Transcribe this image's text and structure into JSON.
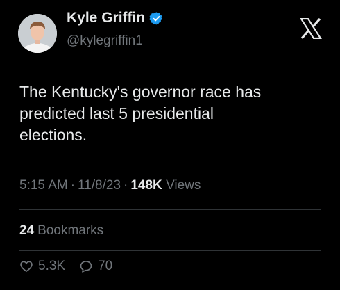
{
  "author": {
    "display_name": "Kyle Griffin",
    "handle": "@kylegriffin1",
    "verified": true,
    "badge_color": "#1d9bf0"
  },
  "brand_icon": "x-logo",
  "tweet": {
    "text_lines": [
      "The Kentucky's governor race has",
      "predicted last 5 presidential",
      "elections."
    ]
  },
  "meta": {
    "time": "5:15 AM",
    "date": "11/8/23",
    "separator": "·",
    "views_count": "148K",
    "views_label": "Views"
  },
  "bookmarks": {
    "count": "24",
    "label": "Bookmarks"
  },
  "actions": {
    "likes": "5.3K",
    "replies": "70"
  }
}
